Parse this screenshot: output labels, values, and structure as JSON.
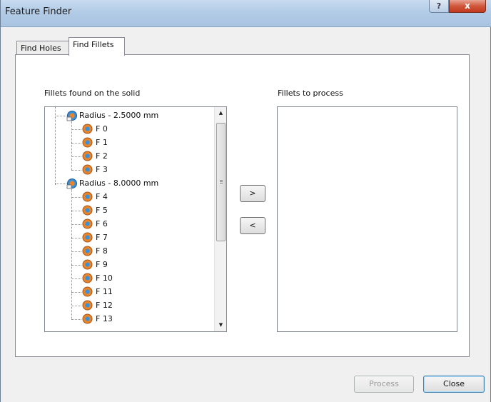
{
  "window": {
    "title": "Feature Finder",
    "help_label": "?",
    "close_label": "x"
  },
  "tabs": [
    {
      "label": "Find Holes",
      "active": false
    },
    {
      "label": "Find Fillets",
      "active": true
    }
  ],
  "found_panel": {
    "label": "Fillets found on the solid",
    "groups": [
      {
        "label": "Radius - 2.5000 mm",
        "items": [
          "F 0",
          "F 1",
          "F 2",
          "F 3"
        ]
      },
      {
        "label": "Radius - 8.0000 mm",
        "items": [
          "F 4",
          "F 5",
          "F 6",
          "F 7",
          "F 8",
          "F 9",
          "F 10",
          "F 11",
          "F 12",
          "F 13"
        ]
      }
    ]
  },
  "process_panel": {
    "label": "Fillets to process",
    "items": []
  },
  "transfer": {
    "add_label": ">",
    "remove_label": "<"
  },
  "footer": {
    "process_label": "Process",
    "close_label": "Close"
  },
  "icons": {
    "group": "fillet-group-icon",
    "item": "fillet-item-icon"
  },
  "colors": {
    "titlebar": "#b2cbe6",
    "close_button": "#c2391d",
    "icon_orange": "#e8842a",
    "icon_blue": "#3a8fd6"
  }
}
